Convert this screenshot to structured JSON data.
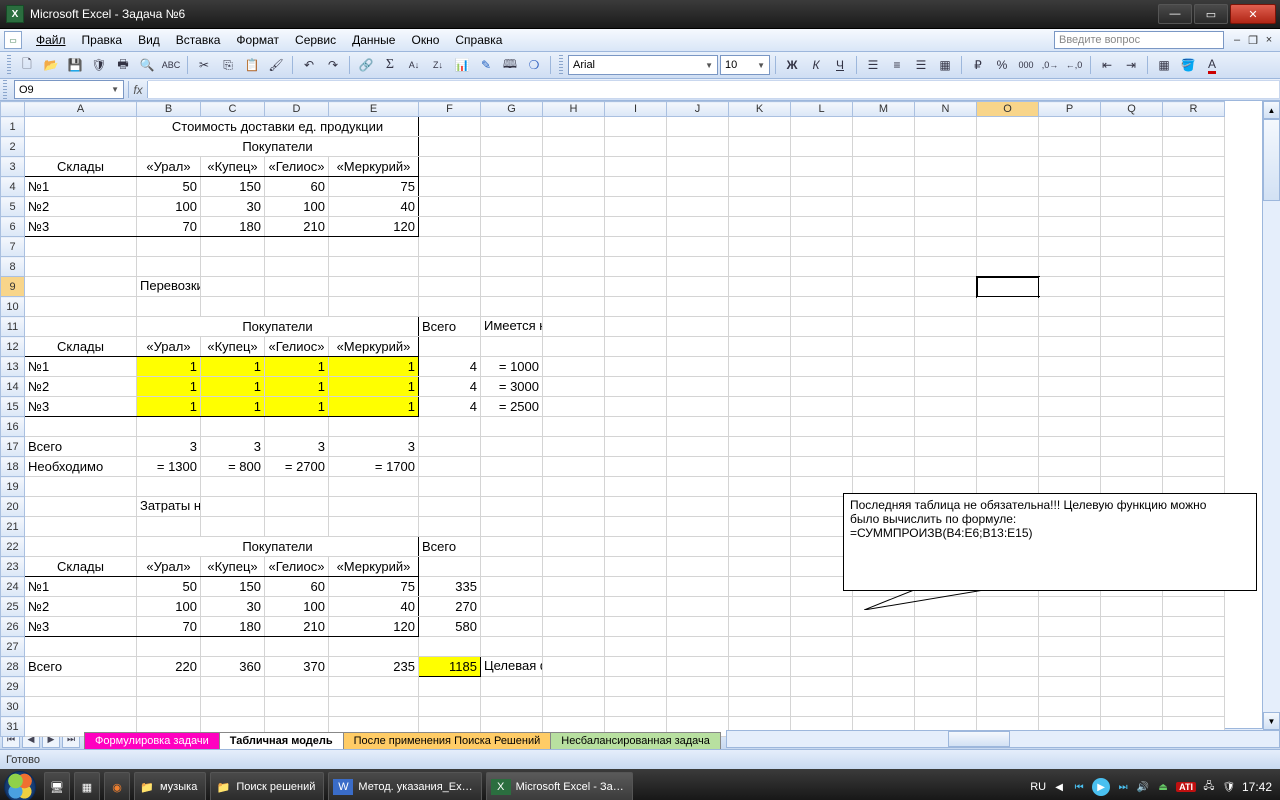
{
  "window": {
    "title": "Microsoft Excel - Задача №6"
  },
  "menu": {
    "file": "Файл",
    "edit": "Правка",
    "view": "Вид",
    "insert": "Вставка",
    "format": "Формат",
    "tools": "Сервис",
    "data": "Данные",
    "window": "Окно",
    "help": "Справка",
    "question_placeholder": "Введите вопрос"
  },
  "toolbar": {
    "font": "Arial",
    "size": "10"
  },
  "namebox": "O9",
  "formula": "",
  "columns": [
    "A",
    "B",
    "C",
    "D",
    "E",
    "F",
    "G",
    "H",
    "I",
    "J",
    "K",
    "L",
    "M",
    "N",
    "O",
    "P",
    "Q",
    "R"
  ],
  "col_widths": {
    "rh": 24,
    "A": 112,
    "B": 64,
    "C": 64,
    "D": 64,
    "E": 90,
    "F": 62,
    "G": 62,
    "default": 62
  },
  "rows": 31,
  "selected": {
    "col": "O",
    "row": 9
  },
  "cells": {
    "1": {
      "B": {
        "v": "Стоимость доставки ед. продукции",
        "span": 4,
        "bT": 1,
        "bL": 1,
        "bR": 1,
        "al": "ac"
      }
    },
    "2": {
      "A": {
        "v": "",
        "bT": 1,
        "bL": 1
      },
      "B": {
        "v": "Покупатели",
        "span": 4,
        "bT": 1,
        "bL": 1,
        "bR": 1,
        "al": "ac"
      }
    },
    "3": {
      "A": {
        "v": "Склады",
        "al": "ac",
        "bL": 1,
        "bB": 1
      },
      "B": {
        "v": "«Урал»",
        "al": "ac",
        "bL": 1,
        "bT": 1,
        "bB": 1
      },
      "C": {
        "v": "«Купец»",
        "al": "ac",
        "bL": 1,
        "bT": 1,
        "bB": 1
      },
      "D": {
        "v": "«Гелиос»",
        "al": "ac",
        "bL": 1,
        "bT": 1,
        "bB": 1
      },
      "E": {
        "v": "«Меркурий»",
        "al": "ac",
        "bL": 1,
        "bT": 1,
        "bR": 1,
        "bB": 1
      }
    },
    "4": {
      "A": {
        "v": "№1",
        "bL": 1,
        "bT": 1
      },
      "B": {
        "v": "50",
        "ar": 1,
        "bL": 1,
        "bT": 1
      },
      "C": {
        "v": "150",
        "ar": 1,
        "bL": 1,
        "bT": 1
      },
      "D": {
        "v": "60",
        "ar": 1,
        "bL": 1,
        "bT": 1
      },
      "E": {
        "v": "75",
        "ar": 1,
        "bL": 1,
        "bR": 1,
        "bT": 1
      }
    },
    "5": {
      "A": {
        "v": "№2",
        "bL": 1
      },
      "B": {
        "v": "100",
        "ar": 1,
        "bL": 1
      },
      "C": {
        "v": "30",
        "ar": 1,
        "bL": 1
      },
      "D": {
        "v": "100",
        "ar": 1,
        "bL": 1
      },
      "E": {
        "v": "40",
        "ar": 1,
        "bL": 1,
        "bR": 1
      }
    },
    "6": {
      "A": {
        "v": "№3",
        "bL": 1,
        "bB": 1
      },
      "B": {
        "v": "70",
        "ar": 1,
        "bL": 1,
        "bB": 1
      },
      "C": {
        "v": "180",
        "ar": 1,
        "bL": 1,
        "bB": 1
      },
      "D": {
        "v": "210",
        "ar": 1,
        "bL": 1,
        "bB": 1
      },
      "E": {
        "v": "120",
        "ar": 1,
        "bL": 1,
        "bR": 1,
        "bB": 1
      }
    },
    "9": {
      "B": {
        "v": "Перевозки (кол-во продукции)",
        "of": 1
      }
    },
    "11": {
      "A": {
        "v": "",
        "bT": 1,
        "bL": 1
      },
      "B": {
        "v": "Покупатели",
        "span": 4,
        "al": "ac",
        "bT": 1,
        "bL": 1,
        "bR": 1
      },
      "F": {
        "v": "Всего"
      },
      "G": {
        "v": "Имеется на складе",
        "of": 1
      }
    },
    "12": {
      "A": {
        "v": "Склады",
        "al": "ac",
        "bL": 1,
        "bB": 1
      },
      "B": {
        "v": "«Урал»",
        "al": "ac",
        "bL": 1,
        "bT": 1,
        "bB": 1
      },
      "C": {
        "v": "«Купец»",
        "al": "ac",
        "bL": 1,
        "bT": 1,
        "bB": 1
      },
      "D": {
        "v": "«Гелиос»",
        "al": "ac",
        "bL": 1,
        "bT": 1,
        "bB": 1
      },
      "E": {
        "v": "«Меркурий»",
        "al": "ac",
        "bL": 1,
        "bT": 1,
        "bR": 1,
        "bB": 1
      }
    },
    "13": {
      "A": {
        "v": "№1",
        "bL": 1,
        "bT": 1
      },
      "B": {
        "v": "1",
        "ar": 1,
        "bL": 1,
        "bT": 1,
        "yel": 1
      },
      "C": {
        "v": "1",
        "ar": 1,
        "bL": 1,
        "bT": 1,
        "yel": 1
      },
      "D": {
        "v": "1",
        "ar": 1,
        "bL": 1,
        "bT": 1,
        "yel": 1
      },
      "E": {
        "v": "1",
        "ar": 1,
        "bL": 1,
        "bR": 1,
        "bT": 1,
        "yel": 1
      },
      "F": {
        "v": "4",
        "ar": 1
      },
      "G": {
        "v": "= 1000",
        "ar": 1
      }
    },
    "14": {
      "A": {
        "v": "№2",
        "bL": 1
      },
      "B": {
        "v": "1",
        "ar": 1,
        "bL": 1,
        "yel": 1
      },
      "C": {
        "v": "1",
        "ar": 1,
        "bL": 1,
        "yel": 1
      },
      "D": {
        "v": "1",
        "ar": 1,
        "bL": 1,
        "yel": 1
      },
      "E": {
        "v": "1",
        "ar": 1,
        "bL": 1,
        "bR": 1,
        "yel": 1
      },
      "F": {
        "v": "4",
        "ar": 1
      },
      "G": {
        "v": "= 3000",
        "ar": 1
      }
    },
    "15": {
      "A": {
        "v": "№3",
        "bL": 1,
        "bB": 1
      },
      "B": {
        "v": "1",
        "ar": 1,
        "bL": 1,
        "bB": 1,
        "yel": 1
      },
      "C": {
        "v": "1",
        "ar": 1,
        "bL": 1,
        "bB": 1,
        "yel": 1
      },
      "D": {
        "v": "1",
        "ar": 1,
        "bL": 1,
        "bB": 1,
        "yel": 1
      },
      "E": {
        "v": "1",
        "ar": 1,
        "bL": 1,
        "bR": 1,
        "bB": 1,
        "yel": 1
      },
      "F": {
        "v": "4",
        "ar": 1
      },
      "G": {
        "v": "= 2500",
        "ar": 1
      }
    },
    "17": {
      "A": {
        "v": "Всего"
      },
      "B": {
        "v": "3",
        "ar": 1
      },
      "C": {
        "v": "3",
        "ar": 1
      },
      "D": {
        "v": "3",
        "ar": 1
      },
      "E": {
        "v": "3",
        "ar": 1
      }
    },
    "18": {
      "A": {
        "v": "Необходимо"
      },
      "B": {
        "v": "= 1300",
        "ar": 1
      },
      "C": {
        "v": "= 800",
        "ar": 1
      },
      "D": {
        "v": "= 2700",
        "ar": 1
      },
      "E": {
        "v": "= 1700",
        "ar": 1
      }
    },
    "20": {
      "B": {
        "v": "Затраты на перевозки",
        "of": 1
      }
    },
    "22": {
      "A": {
        "v": "",
        "bT": 1,
        "bL": 1
      },
      "B": {
        "v": "Покупатели",
        "span": 4,
        "al": "ac",
        "bT": 1,
        "bL": 1,
        "bR": 1
      },
      "F": {
        "v": "Всего"
      }
    },
    "23": {
      "A": {
        "v": "Склады",
        "al": "ac",
        "bL": 1,
        "bB": 1
      },
      "B": {
        "v": "«Урал»",
        "al": "ac",
        "bL": 1,
        "bT": 1,
        "bB": 1
      },
      "C": {
        "v": "«Купец»",
        "al": "ac",
        "bL": 1,
        "bT": 1,
        "bB": 1
      },
      "D": {
        "v": "«Гелиос»",
        "al": "ac",
        "bL": 1,
        "bT": 1,
        "bB": 1
      },
      "E": {
        "v": "«Меркурий»",
        "al": "ac",
        "bL": 1,
        "bT": 1,
        "bR": 1,
        "bB": 1
      }
    },
    "24": {
      "A": {
        "v": "№1",
        "bL": 1,
        "bT": 1
      },
      "B": {
        "v": "50",
        "ar": 1,
        "bL": 1,
        "bT": 1
      },
      "C": {
        "v": "150",
        "ar": 1,
        "bL": 1,
        "bT": 1
      },
      "D": {
        "v": "60",
        "ar": 1,
        "bL": 1,
        "bT": 1
      },
      "E": {
        "v": "75",
        "ar": 1,
        "bL": 1,
        "bR": 1,
        "bT": 1
      },
      "F": {
        "v": "335",
        "ar": 1
      }
    },
    "25": {
      "A": {
        "v": "№2",
        "bL": 1
      },
      "B": {
        "v": "100",
        "ar": 1,
        "bL": 1
      },
      "C": {
        "v": "30",
        "ar": 1,
        "bL": 1
      },
      "D": {
        "v": "100",
        "ar": 1,
        "bL": 1
      },
      "E": {
        "v": "40",
        "ar": 1,
        "bL": 1,
        "bR": 1
      },
      "F": {
        "v": "270",
        "ar": 1
      }
    },
    "26": {
      "A": {
        "v": "№3",
        "bL": 1,
        "bB": 1
      },
      "B": {
        "v": "70",
        "ar": 1,
        "bL": 1,
        "bB": 1
      },
      "C": {
        "v": "180",
        "ar": 1,
        "bL": 1,
        "bB": 1
      },
      "D": {
        "v": "210",
        "ar": 1,
        "bL": 1,
        "bB": 1
      },
      "E": {
        "v": "120",
        "ar": 1,
        "bL": 1,
        "bR": 1,
        "bB": 1
      },
      "F": {
        "v": "580",
        "ar": 1
      }
    },
    "28": {
      "A": {
        "v": "Всего"
      },
      "B": {
        "v": "220",
        "ar": 1
      },
      "C": {
        "v": "360",
        "ar": 1
      },
      "D": {
        "v": "370",
        "ar": 1
      },
      "E": {
        "v": "235",
        "ar": 1
      },
      "F": {
        "v": "1185",
        "ar": 1,
        "bA": 1,
        "yel": 1
      },
      "G": {
        "v": "Целевая функция",
        "of": 1
      }
    }
  },
  "textbox": {
    "lines": [
      "Последняя таблица не обязательна!!! Целевую функцию можно",
      "было вычислить по формуле:",
      "=СУММПРОИЗВ(B4:E6;B13:E15)"
    ]
  },
  "tabs": {
    "t1": "Формулировка задачи",
    "t2": "Табличная модель",
    "t3": "После применения Поиска Решений",
    "t4": "Несбалансированная задача"
  },
  "status": "Готово",
  "taskbar": {
    "items": [
      {
        "label": "музыка"
      },
      {
        "label": "Поиск решений"
      },
      {
        "label": "Метод. указания_Ex…"
      },
      {
        "label": "Microsoft Excel - За…"
      }
    ],
    "lang": "RU",
    "time": "17:42"
  }
}
